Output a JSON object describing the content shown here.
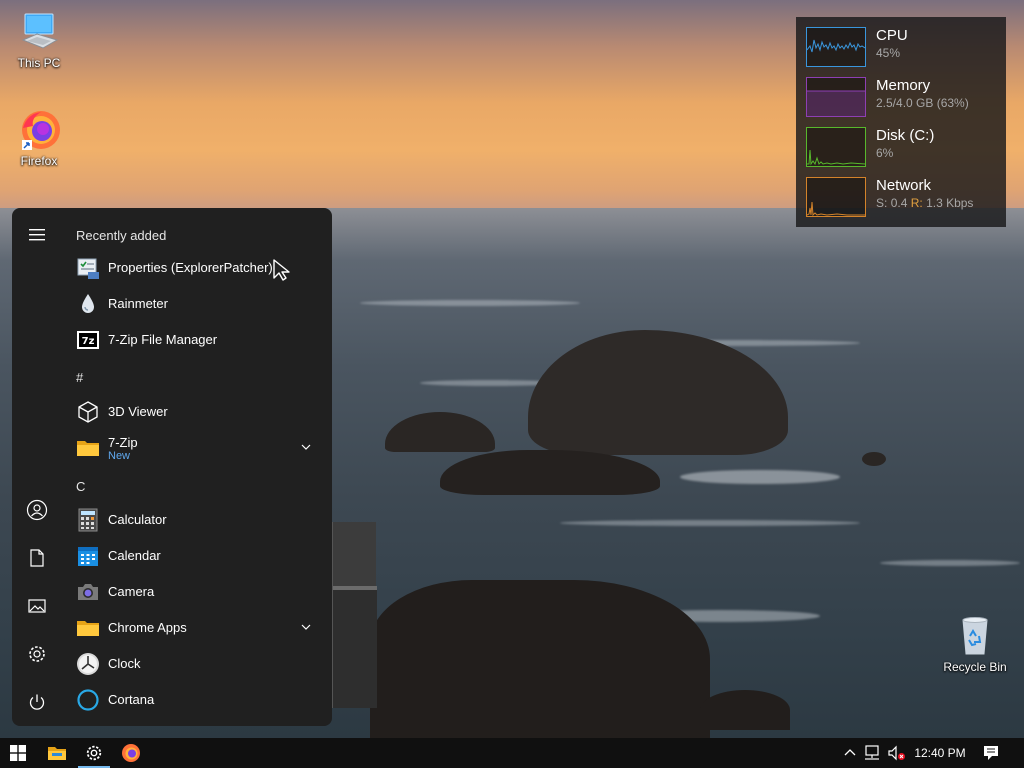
{
  "desktop": {
    "icons": [
      {
        "label": "This PC",
        "icon": "this-pc-icon"
      },
      {
        "label": "Firefox",
        "icon": "firefox-icon"
      },
      {
        "label": "Recycle Bin",
        "icon": "recycle-bin-icon"
      }
    ]
  },
  "system_monitor": {
    "cpu": {
      "title": "CPU",
      "value": "45%",
      "color": "#3a96dd"
    },
    "memory": {
      "title": "Memory",
      "value": "2.5/4.0 GB (63%)",
      "color": "#8e3fb4"
    },
    "disk": {
      "title": "Disk (C:)",
      "value": "6%",
      "color": "#58b82c"
    },
    "network": {
      "title": "Network",
      "sent_label": "S:",
      "sent": "0.4",
      "recv_label": "R:",
      "recv": "1.3 Kbps",
      "color": "#d4832a"
    }
  },
  "start_menu": {
    "sections": {
      "recent": "Recently added",
      "hash": "#",
      "c": "C"
    },
    "recent_items": [
      {
        "label": "Properties (ExplorerPatcher)",
        "icon": "properties-icon"
      },
      {
        "label": "Rainmeter",
        "icon": "rainmeter-drop-icon"
      },
      {
        "label": "7-Zip File Manager",
        "icon": "7zip-icon"
      }
    ],
    "hash_items": [
      {
        "label": "3D Viewer",
        "icon": "cube-icon"
      },
      {
        "label": "7-Zip",
        "sub": "New",
        "icon": "folder-icon"
      }
    ],
    "c_items": [
      {
        "label": "Calculator",
        "icon": "calculator-icon"
      },
      {
        "label": "Calendar",
        "icon": "calendar-icon"
      },
      {
        "label": "Camera",
        "icon": "camera-icon"
      },
      {
        "label": "Chrome Apps",
        "icon": "folder-icon"
      },
      {
        "label": "Clock",
        "icon": "clock-icon"
      },
      {
        "label": "Cortana",
        "icon": "cortana-icon"
      }
    ],
    "rail": [
      "hamburger-icon",
      "user-icon",
      "document-icon",
      "pictures-icon",
      "gear-icon",
      "power-icon"
    ]
  },
  "taskbar": {
    "clock": "12:40 PM",
    "pinned": [
      "windows-logo-icon",
      "file-explorer-icon",
      "settings-icon",
      "firefox-icon"
    ],
    "tray": [
      "chevron-up-icon",
      "network-icon",
      "volume-muted-icon",
      "action-center-icon"
    ]
  }
}
